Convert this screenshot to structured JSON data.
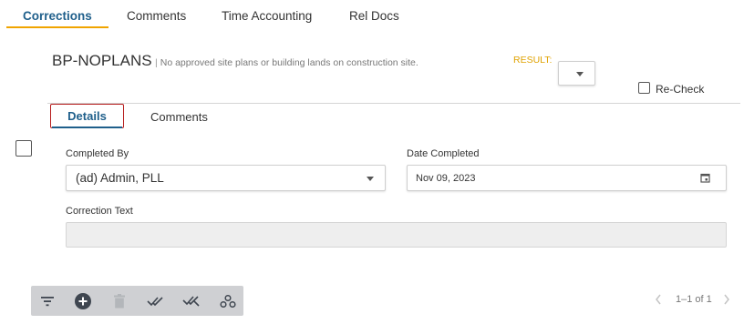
{
  "top_tabs": [
    {
      "label": "Corrections",
      "active": true
    },
    {
      "label": "Comments",
      "active": false
    },
    {
      "label": "Time Accounting",
      "active": false
    },
    {
      "label": "Rel Docs",
      "active": false
    }
  ],
  "correction": {
    "code": "BP-NOPLANS",
    "separator": "|",
    "description": "No approved site plans or building lands on construction site.",
    "result_label": "RESULT:",
    "result_value": "",
    "recheck_label": "Re-Check",
    "recheck_checked": false
  },
  "inner_tabs": [
    {
      "label": "Details",
      "active": true
    },
    {
      "label": "Comments",
      "active": false
    }
  ],
  "form": {
    "completed_by_label": "Completed By",
    "completed_by_value": "(ad) Admin, PLL",
    "date_completed_label": "Date Completed",
    "date_completed_value": "Nov 09, 2023",
    "correction_text_label": "Correction Text",
    "correction_text_value": ""
  },
  "toolbar": {
    "icons": [
      "filter-icon",
      "add-icon",
      "delete-icon",
      "double-check-icon",
      "double-x-icon",
      "settings-icon"
    ]
  },
  "pager": {
    "text": "1–1 of 1"
  },
  "colors": {
    "active_tab": "#1f5f8b",
    "tab_underline": "#f0a400",
    "result_label": "#e0a200",
    "focus_border": "#b71c1c",
    "toolbar_bg": "#cfd0d3"
  }
}
